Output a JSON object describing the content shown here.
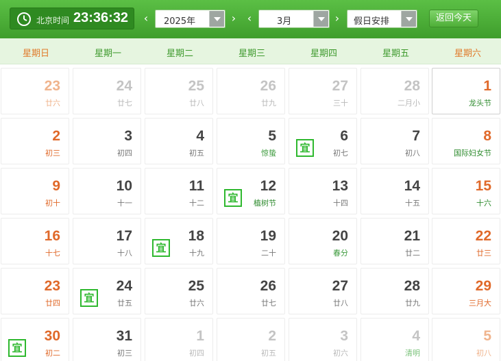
{
  "toolbar": {
    "clock_label": "北京时间",
    "clock_time": "23:36:32",
    "prev_arrow": "‹",
    "next_arrow": "›",
    "year_value": "2025年",
    "month_value": "3月",
    "holiday_value": "假日安排",
    "today_label": "返回今天"
  },
  "weekdays": [
    "星期日",
    "星期一",
    "星期二",
    "星期三",
    "星期四",
    "星期五",
    "星期六"
  ],
  "yi_label": "宜",
  "weeks": [
    [
      {
        "day": "23",
        "lunar": "廿六",
        "other": true
      },
      {
        "day": "24",
        "lunar": "廿七",
        "other": true
      },
      {
        "day": "25",
        "lunar": "廿八",
        "other": true
      },
      {
        "day": "26",
        "lunar": "廿九",
        "other": true
      },
      {
        "day": "27",
        "lunar": "三十",
        "other": true
      },
      {
        "day": "28",
        "lunar": "二月小",
        "other": true
      },
      {
        "day": "1",
        "lunar": "龙头节",
        "festival": true
      }
    ],
    [
      {
        "day": "2",
        "lunar": "初三"
      },
      {
        "day": "3",
        "lunar": "初四"
      },
      {
        "day": "4",
        "lunar": "初五"
      },
      {
        "day": "5",
        "lunar": "惊蛰",
        "term": true
      },
      {
        "day": "6",
        "lunar": "初七",
        "yi": true
      },
      {
        "day": "7",
        "lunar": "初八"
      },
      {
        "day": "8",
        "lunar": "国际妇女节",
        "festival": true
      }
    ],
    [
      {
        "day": "9",
        "lunar": "初十"
      },
      {
        "day": "10",
        "lunar": "十一"
      },
      {
        "day": "11",
        "lunar": "十二"
      },
      {
        "day": "12",
        "lunar": "植树节",
        "festival": true,
        "yi": true
      },
      {
        "day": "13",
        "lunar": "十四"
      },
      {
        "day": "14",
        "lunar": "十五"
      },
      {
        "day": "15",
        "lunar": "十六",
        "festival": true
      }
    ],
    [
      {
        "day": "16",
        "lunar": "十七"
      },
      {
        "day": "17",
        "lunar": "十八"
      },
      {
        "day": "18",
        "lunar": "十九",
        "yi": true
      },
      {
        "day": "19",
        "lunar": "二十"
      },
      {
        "day": "20",
        "lunar": "春分",
        "term": true
      },
      {
        "day": "21",
        "lunar": "廿二"
      },
      {
        "day": "22",
        "lunar": "廿三"
      }
    ],
    [
      {
        "day": "23",
        "lunar": "廿四"
      },
      {
        "day": "24",
        "lunar": "廿五",
        "yi": true
      },
      {
        "day": "25",
        "lunar": "廿六"
      },
      {
        "day": "26",
        "lunar": "廿七"
      },
      {
        "day": "27",
        "lunar": "廿八"
      },
      {
        "day": "28",
        "lunar": "廿九"
      },
      {
        "day": "29",
        "lunar": "三月大"
      }
    ],
    [
      {
        "day": "30",
        "lunar": "初二",
        "yi": true
      },
      {
        "day": "31",
        "lunar": "初三"
      },
      {
        "day": "1",
        "lunar": "初四",
        "other": true
      },
      {
        "day": "2",
        "lunar": "初五",
        "other": true
      },
      {
        "day": "3",
        "lunar": "初六",
        "other": true
      },
      {
        "day": "4",
        "lunar": "清明",
        "other": true,
        "term": true
      },
      {
        "day": "5",
        "lunar": "初八",
        "other": true
      }
    ]
  ],
  "colors": {
    "toolbar_green": "#4aad36",
    "weekend_orange": "#e0692a",
    "festival_green": "#2e8b2e",
    "yi_green": "#2eb82e"
  }
}
